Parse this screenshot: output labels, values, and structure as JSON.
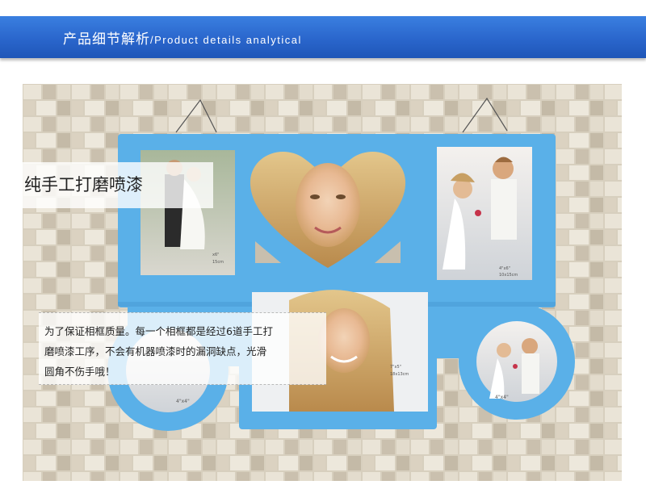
{
  "banner": {
    "title_cn": "产品细节解析",
    "title_en": "/Product details analytical"
  },
  "caption": {
    "heading": "纯手工打磨喷漆",
    "description_lines": [
      "为了保证相框质量。每一个相框都是经过6道手工打",
      "磨喷漆工序，不会有机器喷漆时的漏洞缺点，光滑",
      "圆角不伤手哦！"
    ]
  },
  "frame_labels": {
    "top_left": [
      "x6\"",
      "15cm"
    ],
    "top_right": [
      "4\"x6\"",
      "10x15cm"
    ],
    "center_bottom": [
      "7\"x5\"",
      "18x13cm"
    ],
    "bottom_right": "4\"x4\"",
    "bottom_left": "4\"x4\""
  },
  "colors": {
    "banner_blue": "#2a66cc",
    "frame_blue": "#5ab0e8",
    "wall_stone": "#d9d2c3"
  }
}
